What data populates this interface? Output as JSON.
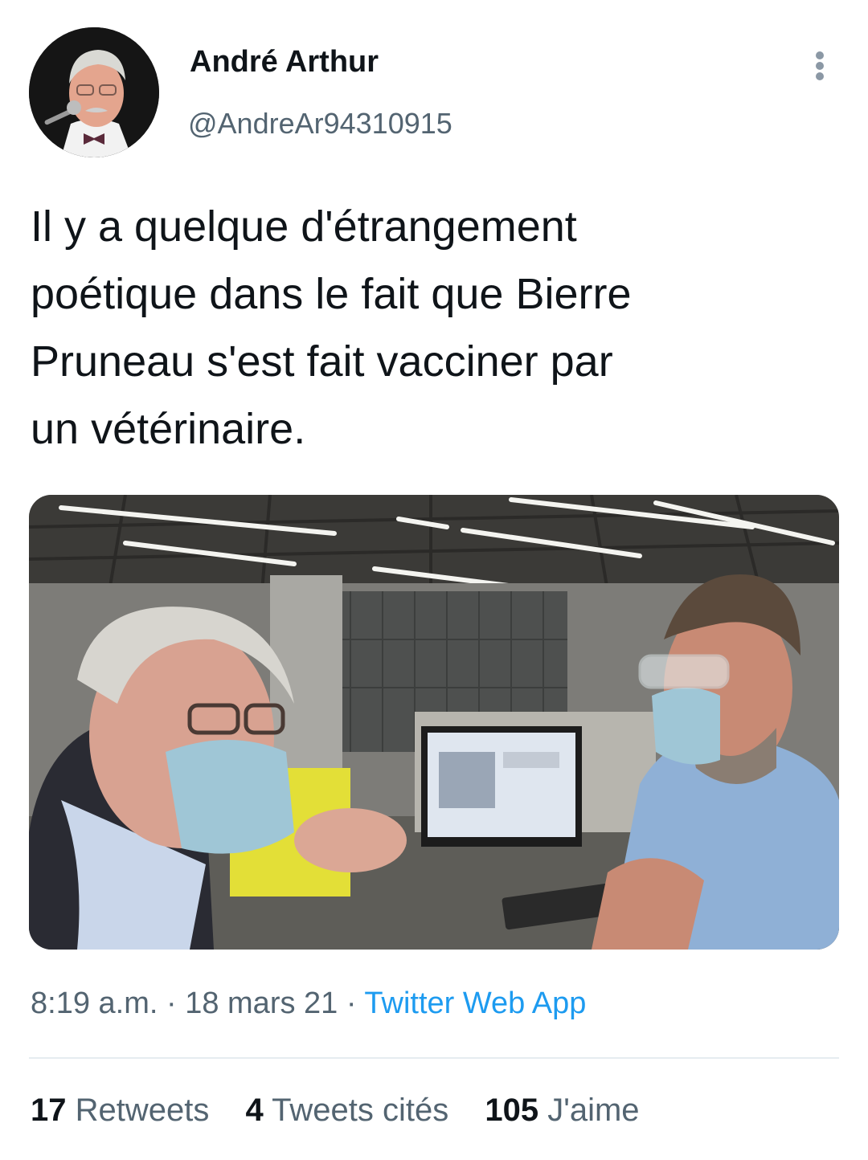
{
  "author": {
    "name": "André Arthur",
    "handle": "@AndreAr94310915",
    "avatar_icon": "profile-photo"
  },
  "tweet": {
    "lines": [
      "Il y a quelque d'étrangement",
      "poétique dans le fait que Bierre",
      "Pruneau s'est fait vacciner par",
      "un vétérinaire."
    ]
  },
  "meta": {
    "time": "8:19 a.m.",
    "separator": "·",
    "date": "18 mars 21",
    "source": "Twitter Web App"
  },
  "stats": {
    "retweets_count": "17",
    "retweets_label": "Retweets",
    "quotes_count": "4",
    "quotes_label": "Tweets cités",
    "likes_count": "105",
    "likes_label": "J'aime"
  },
  "colors": {
    "text": "#0f1419",
    "secondary": "#536471",
    "link": "#1d9bf0",
    "divider": "#e6ecf0"
  },
  "icons": {
    "more": "more-vertical-icon"
  }
}
